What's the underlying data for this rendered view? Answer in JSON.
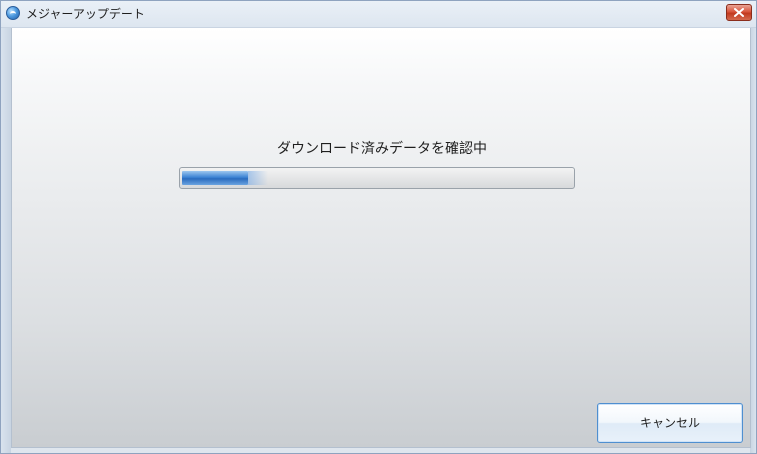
{
  "window": {
    "title": "メジャーアップデート",
    "app_icon": "update-globe-icon",
    "close_icon": "close-icon"
  },
  "main": {
    "status_text": "ダウンロード済みデータを確認中",
    "progress_fraction": 0.17
  },
  "buttons": {
    "cancel_label": "キャンセル"
  },
  "colors": {
    "progress_fill": "#3d83d4",
    "close_button": "#c23a1f",
    "focus_border": "#4f8fd0"
  }
}
